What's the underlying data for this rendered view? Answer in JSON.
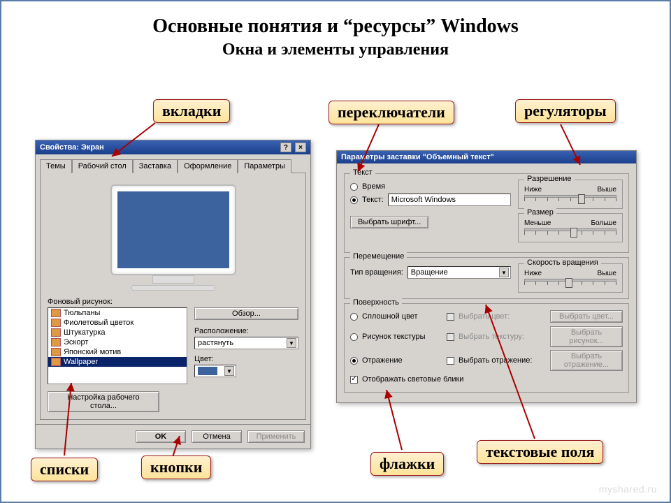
{
  "heading": {
    "title": "Основные понятия   и “ресурсы” Windows",
    "subtitle": "Окна и элементы управления"
  },
  "annotations": {
    "tabs": "вкладки",
    "radios": "переключатели",
    "sliders": "регуляторы",
    "lists": "списки",
    "buttons": "кнопки",
    "checkboxes": "флажки",
    "textfields": "текстовые поля"
  },
  "left_dialog": {
    "title": "Свойства: Экран",
    "help_btn": "?",
    "close_btn": "×",
    "tabs": [
      "Темы",
      "Рабочий стол",
      "Заставка",
      "Оформление",
      "Параметры"
    ],
    "active_tab_index": 1,
    "bg_label": "Фоновый рисунок:",
    "list_items": [
      "Тюльпаны",
      "Фиолетовый цветок",
      "Штукатурка",
      "Эскорт",
      "Японский мотив",
      "Wallpaper"
    ],
    "selected_index": 5,
    "browse_btn": "Обзор...",
    "layout_label": "Расположение:",
    "layout_value": "растянуть",
    "color_label": "Цвет:",
    "desktop_btn": "Настройка рабочего стола...",
    "ok": "OK",
    "cancel": "Отмена",
    "apply": "Применить"
  },
  "right_dialog": {
    "title": "Параметры заставки \"Объемный текст\"",
    "grp_text": "Текст",
    "radio_time": "Время",
    "radio_text": "Текст:",
    "text_value": "Microsoft Windows",
    "choose_font_btn": "Выбрать шрифт...",
    "resolution_label": "Разрешение",
    "resolution_low": "Ниже",
    "resolution_high": "Выше",
    "size_label": "Размер",
    "size_low": "Меньше",
    "size_high": "Больше",
    "grp_move": "Перемещение",
    "rotation_label": "Тип вращения:",
    "rotation_value": "Вращение",
    "speed_label": "Скорость вращения",
    "speed_low": "Ниже",
    "speed_high": "Выше",
    "grp_surface": "Поверхность",
    "radio_solid": "Сплошной цвет",
    "radio_texture": "Рисунок текстуры",
    "radio_reflect": "Отражение",
    "chk_choose_color": "Выбрать цвет:",
    "chk_choose_texture": "Выбрать текстуру:",
    "chk_choose_reflect": "Выбрать отражение:",
    "chk_highlights": "Отображать световые блики",
    "btn_choose_color": "Выбрать цвет...",
    "btn_choose_texture": "Выбрать рисунок...",
    "btn_choose_reflect": "Выбрать отражение..."
  },
  "watermark": "myshared.ru"
}
